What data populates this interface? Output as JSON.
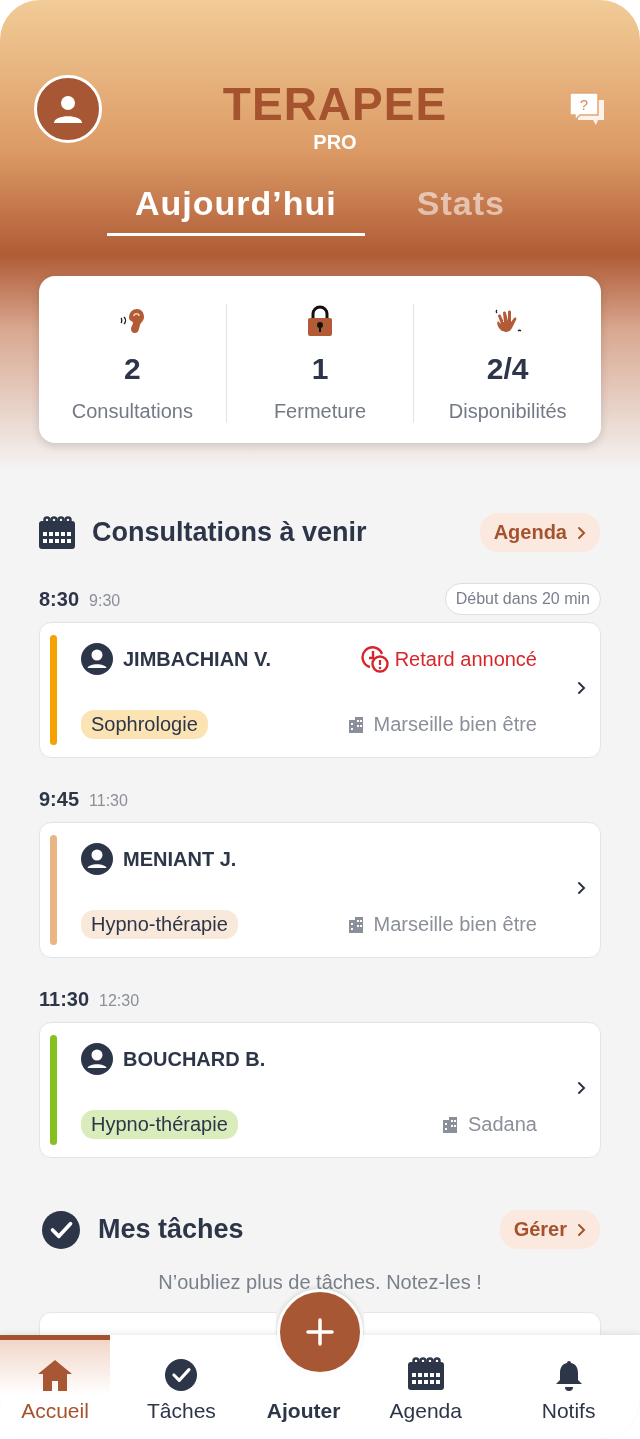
{
  "header": {
    "logo": "TERAPEE",
    "logo_sub": "PRO",
    "help_icon": "?",
    "tabs": [
      {
        "label": "Aujourd’hui",
        "selected": true
      },
      {
        "label": "Stats",
        "selected": false
      }
    ]
  },
  "stats": [
    {
      "kind": "ear",
      "value": "2",
      "label": "Consultations"
    },
    {
      "kind": "lock",
      "value": "1",
      "label": "Fermeture"
    },
    {
      "kind": "hand",
      "value": "2/4",
      "label": "Disponibilités"
    }
  ],
  "upcoming": {
    "title": "Consultations à venir",
    "action": "Agenda",
    "appointments": [
      {
        "start": "8:30",
        "end": "9:30",
        "badge": "Début dans 20 min",
        "name": "JIMBACHIAN V.",
        "alert": "Retard annoncé",
        "tag": "Sophrologie",
        "color": "#f5a200",
        "place": "Marseille bien être"
      },
      {
        "start": "9:45",
        "end": "11:30",
        "name": "MENIANT J.",
        "tag": "Hypno-thérapie",
        "color": "#e8b583",
        "place": "Marseille bien être"
      },
      {
        "start": "11:30",
        "end": "12:30",
        "name": "BOUCHARD B.",
        "tag": "Hypno-thérapie",
        "color": "#84c01e",
        "place": "Sadana"
      }
    ]
  },
  "tasks": {
    "title": "Mes tâches",
    "action": "Gérer",
    "hint": "N’oubliez plus de tâches. Notez-les !"
  },
  "nav": [
    {
      "kind": "home",
      "label": "Accueil",
      "selected": true
    },
    {
      "kind": "check",
      "label": "Tâches",
      "selected": false
    },
    {
      "kind": "add",
      "label": "Ajouter",
      "selected": false
    },
    {
      "kind": "calendar",
      "label": "Agenda",
      "selected": false
    },
    {
      "kind": "bell",
      "label": "Notifs",
      "selected": false
    }
  ]
}
